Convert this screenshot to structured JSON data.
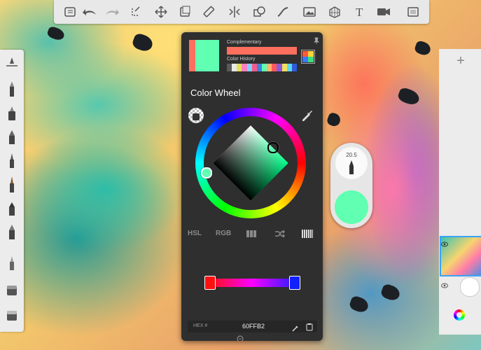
{
  "panel": {
    "complementary_label": "Complementary",
    "color_history_label": "Color History",
    "title": "Color Wheel",
    "tabs": [
      "HSL",
      "RGB"
    ],
    "hex_label": "HEX #",
    "hex_value": "60FFB2"
  },
  "brush": {
    "size": "20.5"
  },
  "colors": {
    "current": "#60FFB2",
    "complementary": "#FF6F5E",
    "history": [
      "#5a5a5a",
      "#e8e8e8",
      "#e2e05a",
      "#ff7fbf",
      "#7fd0ff",
      "#f25a8a",
      "#3a86d8",
      "#60ffb2",
      "#ffb36b",
      "#ff5a5a",
      "#8a5ad8",
      "#f2e05a",
      "#5ad8f2",
      "#2f5ad8"
    ]
  },
  "right_panel": {
    "add_label": "+"
  }
}
